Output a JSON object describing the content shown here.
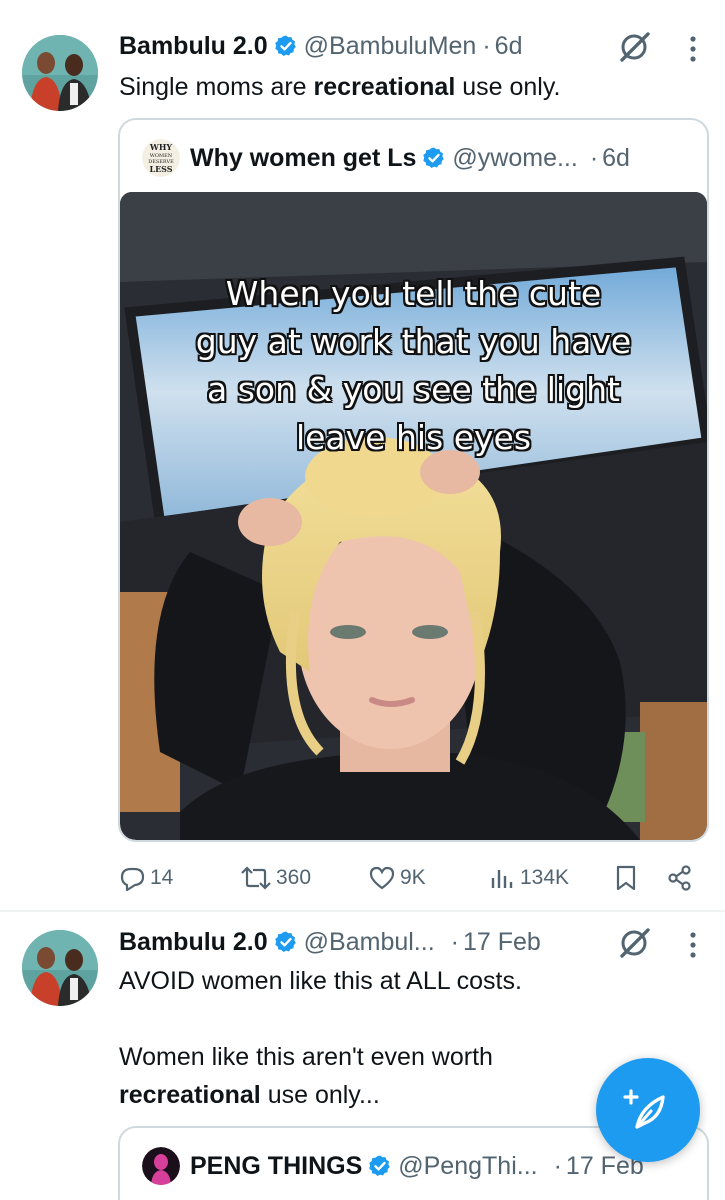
{
  "tweet1": {
    "author_name": "Bambulu 2.0",
    "author_handle": "@BambuluMen",
    "dot": "·",
    "time": "6d",
    "text_before": "Single moms are ",
    "text_bold": "recreational",
    "text_after": " use only.",
    "quote": {
      "author_name": "Why women get Ls",
      "author_handle": "@ywome...",
      "dot": "·",
      "time": "6d",
      "avatar_text": [
        "WHY",
        "WOMEN",
        "DESERVE",
        "LESS"
      ],
      "media_caption_lines": [
        "When you tell the cute",
        "guy at work that you have",
        "a son & you see the light",
        "leave his eyes"
      ]
    },
    "actions": {
      "replies": "14",
      "reposts": "360",
      "likes": "9K",
      "views": "134K"
    }
  },
  "tweet2": {
    "author_name": "Bambulu 2.0",
    "author_handle": "@Bambul...",
    "dot": "·",
    "time": "17 Feb",
    "line1": "AVOID women like this at ALL costs.",
    "line2": "Women like this aren't even worth",
    "line3_bold": "recreational",
    "line3_after": " use only...",
    "quote": {
      "author_name": "PENG THINGS",
      "author_handle": "@PengThi...",
      "dot": "·",
      "time": "17 Feb"
    }
  },
  "colors": {
    "accent": "#1d9bf0",
    "secondary_text": "#536471",
    "border": "#cfd9de"
  },
  "icons": [
    "verified-badge-icon",
    "grok-icon",
    "more-icon",
    "reply-icon",
    "repost-icon",
    "like-icon",
    "views-icon",
    "bookmark-icon",
    "share-icon",
    "compose-icon"
  ]
}
